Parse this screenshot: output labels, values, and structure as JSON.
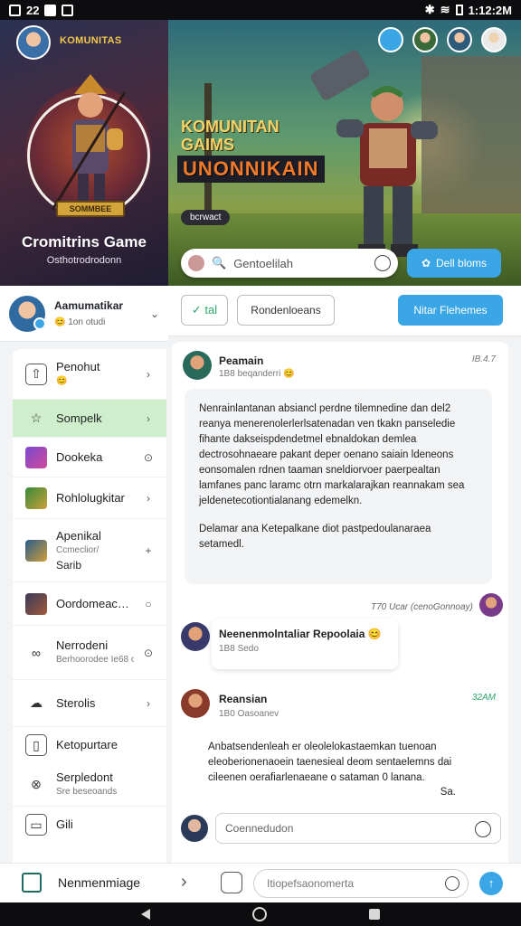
{
  "status_bar": {
    "left_time": "22",
    "right_time": "1:12:2M"
  },
  "hero": {
    "left_tag": "KOMUNITAS",
    "badge": "SOMMBEE",
    "game_title": "Cromitrins Game",
    "game_subtitle": "Osthotrodrodonn",
    "line1": "KOMUNITAN",
    "line2": "GAIMS",
    "line3": "UNONNIKAIN",
    "chip": "bcrwact",
    "search_placeholder": "Gentoelilah",
    "cta_label": "Dell bloms"
  },
  "sidebar_header": {
    "name": "Aamumatikar",
    "status": "1on otudi"
  },
  "sidebar": {
    "items": [
      {
        "label": "Penohut",
        "sub": "😊",
        "end": "›",
        "icon": "shield-icon"
      },
      {
        "label": "Sompelk",
        "sub": "",
        "end": "›",
        "icon": "star-icon"
      },
      {
        "label": "Dookeka",
        "sub": "",
        "end": "⊙",
        "icon": "game-thumb"
      },
      {
        "label": "Rohlolugkitar",
        "sub": "",
        "end": "›",
        "icon": "game-thumb"
      },
      {
        "label": "Apenikal",
        "sub": "Ccmeclior/",
        "sub2": "Sarib",
        "end": "+",
        "icon": "game-thumb"
      },
      {
        "label": "Oordomeacan..",
        "sub": "",
        "end": "○",
        "icon": "game-thumb"
      },
      {
        "label": "Nerrodeni",
        "sub": "Berhoorodee Ie68 on",
        "end": "⊙",
        "icon": "link-icon"
      },
      {
        "label": "Sterolis",
        "sub": "",
        "end": "›",
        "icon": "cloud-icon"
      },
      {
        "label": "Ketopurtare",
        "sub": "",
        "end": "",
        "icon": "door-icon"
      },
      {
        "label": "Serpledont",
        "sub": "Sre beseoands",
        "end": "",
        "icon": "x-icon"
      },
      {
        "label": "Gili",
        "sub": "",
        "end": "",
        "icon": "controller-icon"
      }
    ]
  },
  "toolbar": {
    "btn1": "✓ tal",
    "btn2": "Rondenloeans",
    "btn3": "Nitar Flehemes"
  },
  "feed": {
    "post1": {
      "name": "Peamain",
      "meta": "1B8 beqanderri 😊",
      "time": "IB.4.7",
      "body": "Nenrainlantanan absiancl perdne tilemnedine dan del2 reanya menerenolerlerlsatenadan ven tkakn panseledie fihante dakseispdendetmel ebnaldokan demlea dectrosohnaeare pakant deper oenano saiain ldeneons eonsomalen rdnen taaman sneldiorvoer paerpealtan lamfanes panc laramc otrn markalarajkan reannakam sea jeldenetecotiontialanang edemelkn.",
      "body2": "Delamar ana Ketepalkane diot pastpedoulanaraea setamedl.",
      "reply": "T70 Ucar (cenoGonnoay)"
    },
    "post2": {
      "name": "Neenenmolntaliar Repoolaia 😊",
      "meta": "1B8 Sedo"
    },
    "post3": {
      "name": "Reansian",
      "time": "32AM",
      "meta": "1B0 Oasoanev",
      "body": "Anbatsendenleah er oleolelokastaemkan tuenoan eleoberionenaoein taenesieal deom sentaelemns dai cileenen oerafiarlenaeane o sataman 0 lanana.",
      "end": "Sa."
    },
    "comment_placeholder": "Coennedudon"
  },
  "bottom_bar": {
    "label": "Nenmenmiage",
    "input_placeholder": "Itiopefsaonomerta"
  },
  "colors": {
    "accent": "#3aa6e6",
    "active": "#cfeecc",
    "success": "#2ca66a"
  }
}
